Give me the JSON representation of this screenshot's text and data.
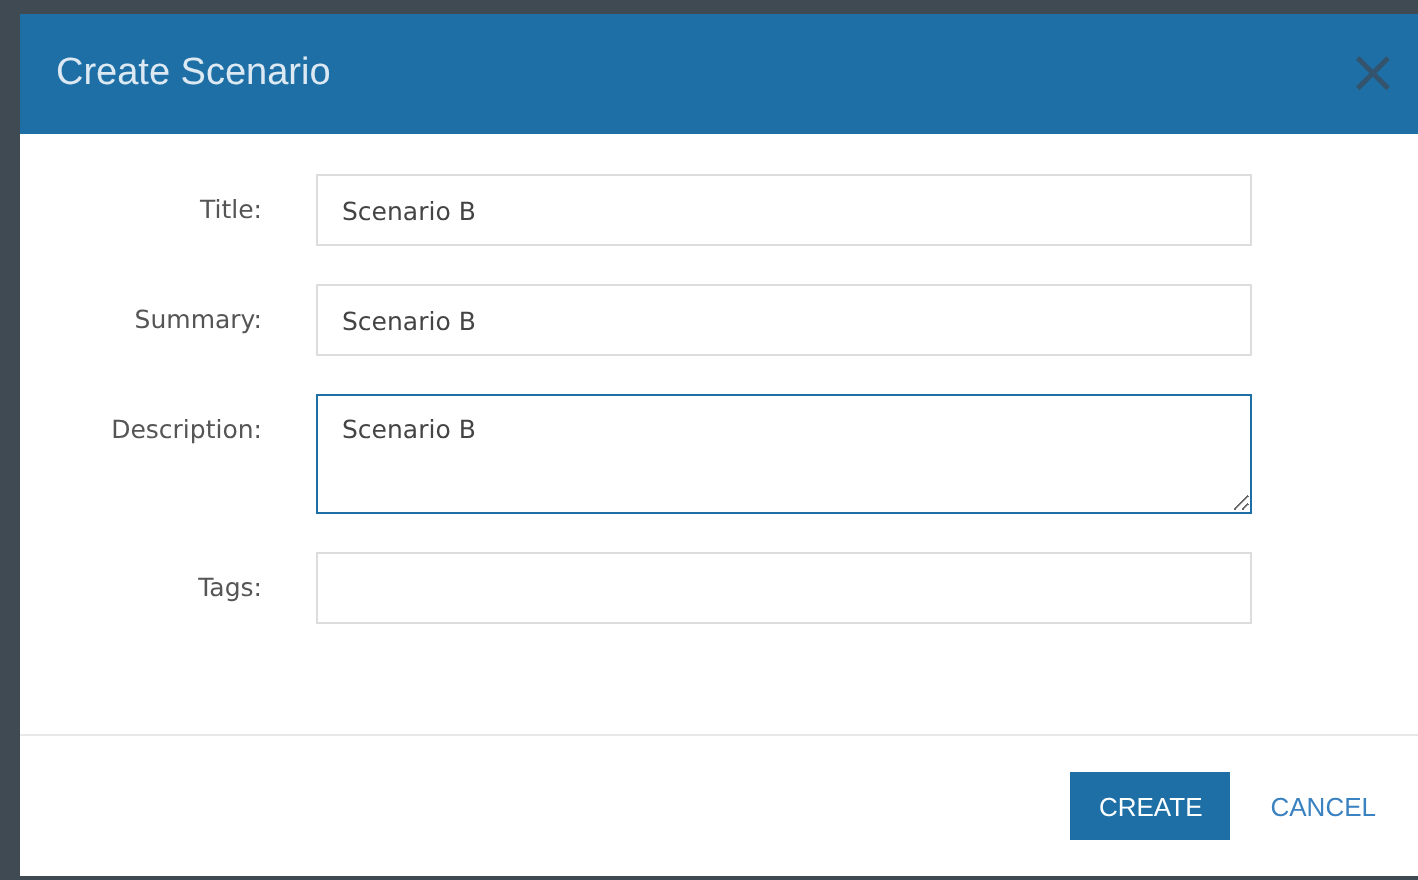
{
  "dialog": {
    "title": "Create Scenario",
    "close": "×"
  },
  "fields": [
    {
      "label": "Title:",
      "kind": "input",
      "value": "Scenario B",
      "focused": false
    },
    {
      "label": "Summary:",
      "kind": "input",
      "value": "Scenario B",
      "focused": false
    },
    {
      "label": "Description:",
      "kind": "textarea",
      "value": "Scenario B",
      "focused": true
    },
    {
      "label": "Tags:",
      "kind": "input",
      "focused": false
    }
  ],
  "buttons": [
    {
      "label": "CREATE",
      "kind": "primary"
    },
    {
      "label": "CANCEL",
      "kind": "link"
    }
  ]
}
